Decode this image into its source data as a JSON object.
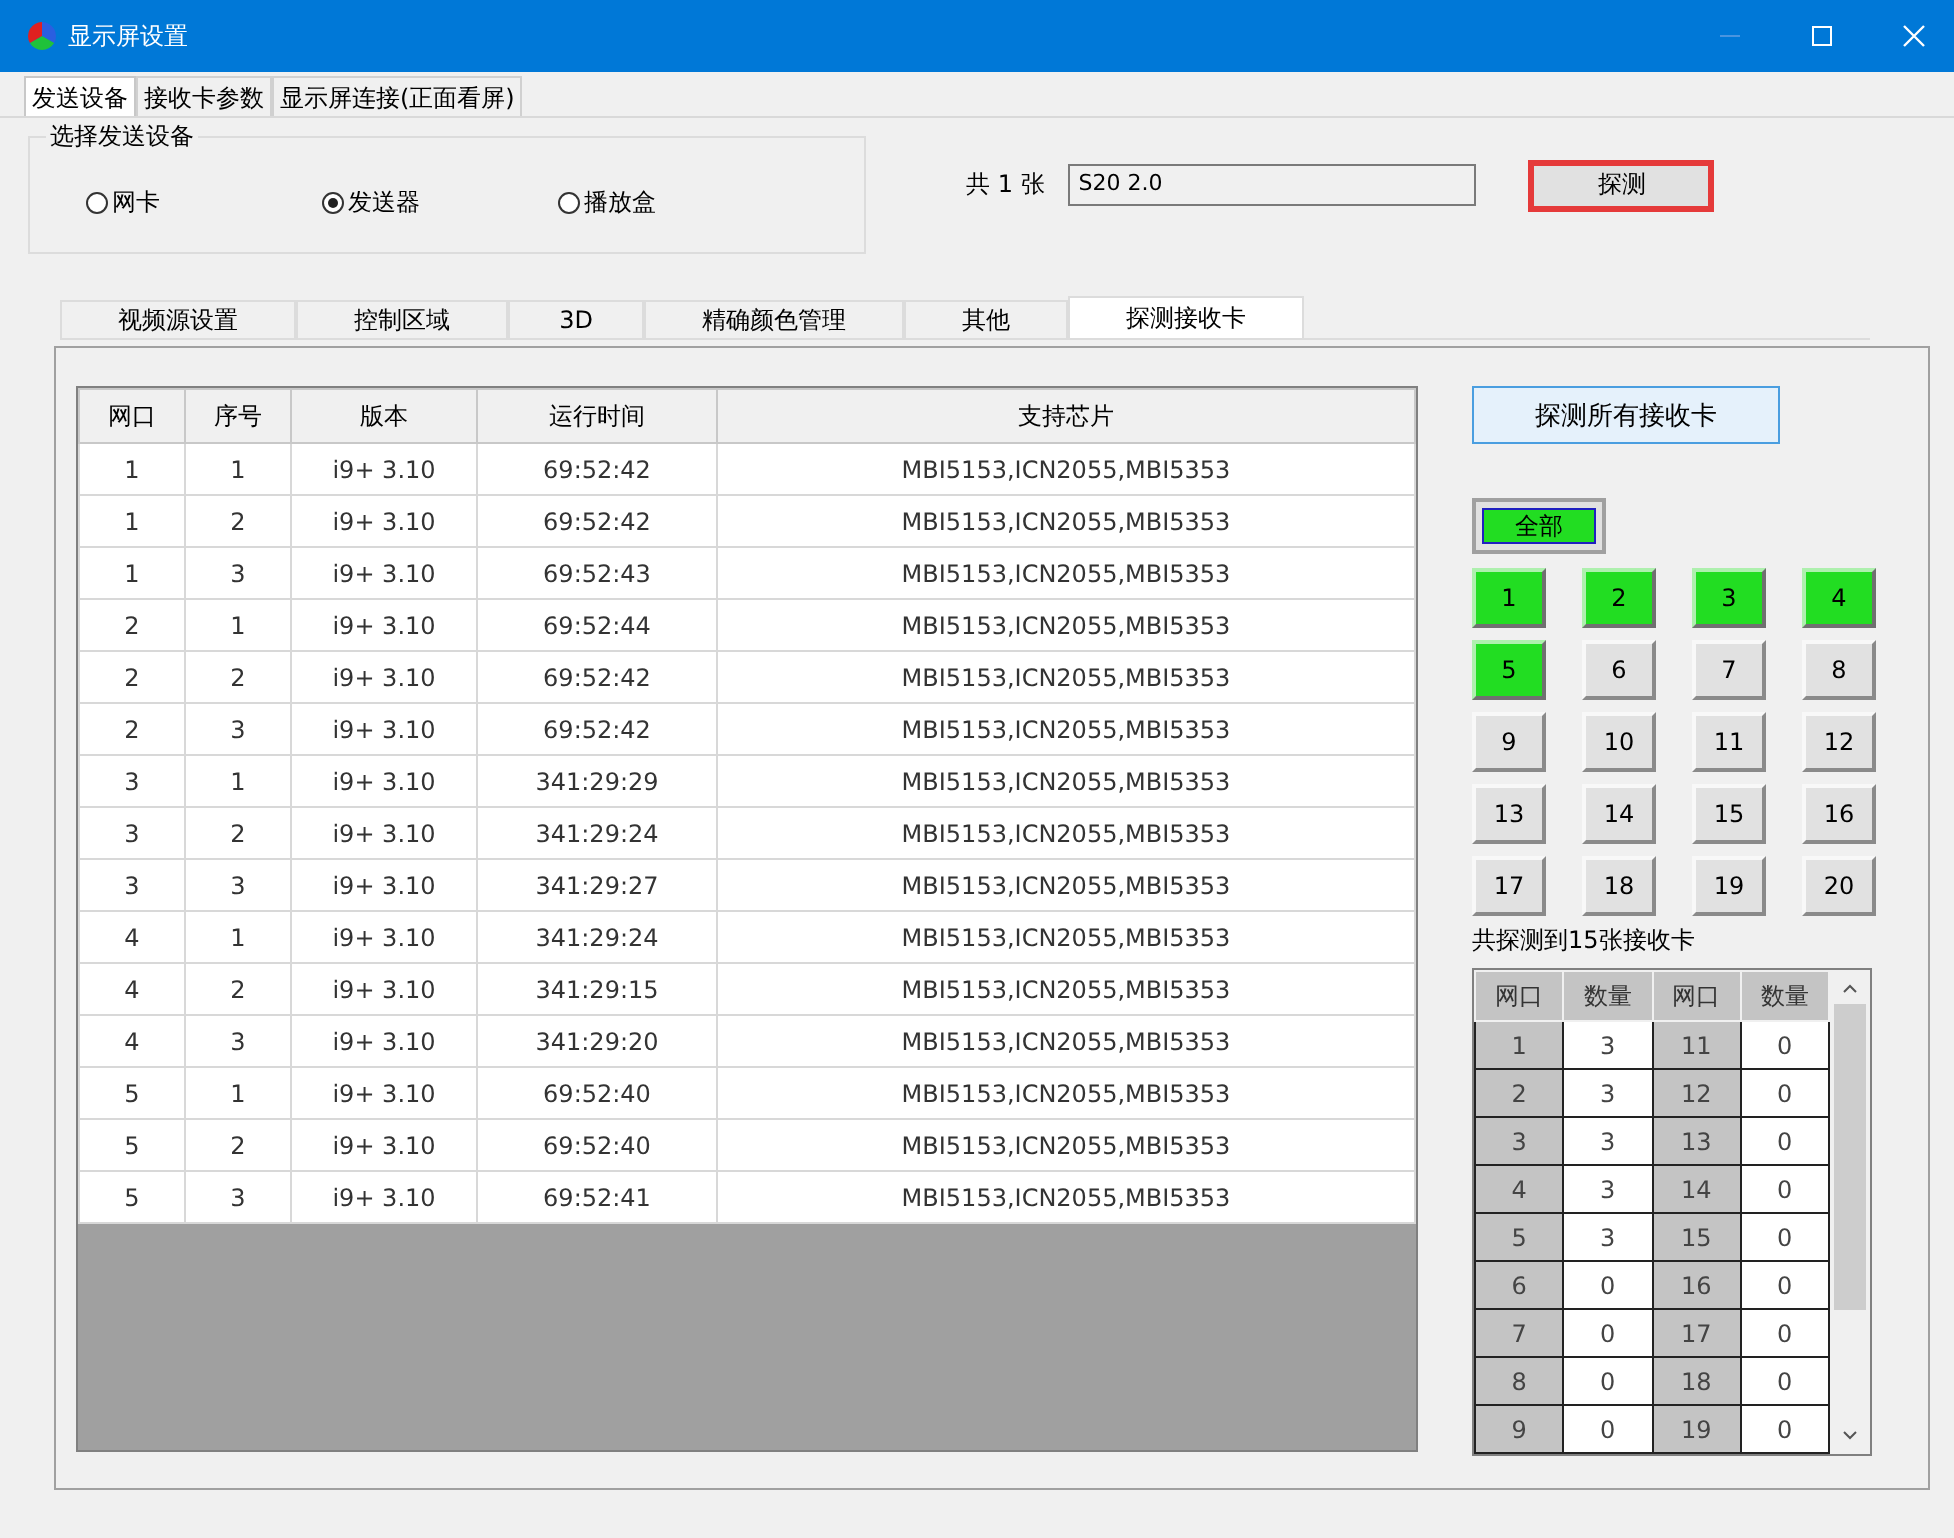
{
  "window": {
    "title": "显示屏设置"
  },
  "top_tabs": [
    {
      "label": "发送设备",
      "selected": true
    },
    {
      "label": "接收卡参数",
      "selected": false
    },
    {
      "label": "显示屏连接(正面看屏)",
      "selected": false
    }
  ],
  "device_group": {
    "title": "选择发送设备",
    "options": [
      {
        "label": "网卡",
        "selected": false
      },
      {
        "label": "发送器",
        "selected": true
      },
      {
        "label": "播放盒",
        "selected": false
      }
    ]
  },
  "count_label": "共 1 张",
  "device_field": {
    "value": "S20 2.0"
  },
  "detect_button": "探测",
  "inner_tabs": [
    {
      "label": "视频源设置",
      "selected": false
    },
    {
      "label": "控制区域",
      "selected": false
    },
    {
      "label": "3D",
      "selected": false
    },
    {
      "label": "精确颜色管理",
      "selected": false
    },
    {
      "label": "其他",
      "selected": false
    },
    {
      "label": "探测接收卡",
      "selected": true
    }
  ],
  "table": {
    "columns": [
      "网口",
      "序号",
      "版本",
      "运行时间",
      "支持芯片"
    ],
    "rows": [
      [
        "1",
        "1",
        "i9+ 3.10",
        "69:52:42",
        "MBI5153,ICN2055,MBI5353"
      ],
      [
        "1",
        "2",
        "i9+ 3.10",
        "69:52:42",
        "MBI5153,ICN2055,MBI5353"
      ],
      [
        "1",
        "3",
        "i9+ 3.10",
        "69:52:43",
        "MBI5153,ICN2055,MBI5353"
      ],
      [
        "2",
        "1",
        "i9+ 3.10",
        "69:52:44",
        "MBI5153,ICN2055,MBI5353"
      ],
      [
        "2",
        "2",
        "i9+ 3.10",
        "69:52:42",
        "MBI5153,ICN2055,MBI5353"
      ],
      [
        "2",
        "3",
        "i9+ 3.10",
        "69:52:42",
        "MBI5153,ICN2055,MBI5353"
      ],
      [
        "3",
        "1",
        "i9+ 3.10",
        "341:29:29",
        "MBI5153,ICN2055,MBI5353"
      ],
      [
        "3",
        "2",
        "i9+ 3.10",
        "341:29:24",
        "MBI5153,ICN2055,MBI5353"
      ],
      [
        "3",
        "3",
        "i9+ 3.10",
        "341:29:27",
        "MBI5153,ICN2055,MBI5353"
      ],
      [
        "4",
        "1",
        "i9+ 3.10",
        "341:29:24",
        "MBI5153,ICN2055,MBI5353"
      ],
      [
        "4",
        "2",
        "i9+ 3.10",
        "341:29:15",
        "MBI5153,ICN2055,MBI5353"
      ],
      [
        "4",
        "3",
        "i9+ 3.10",
        "341:29:20",
        "MBI5153,ICN2055,MBI5353"
      ],
      [
        "5",
        "1",
        "i9+ 3.10",
        "69:52:40",
        "MBI5153,ICN2055,MBI5353"
      ],
      [
        "5",
        "2",
        "i9+ 3.10",
        "69:52:40",
        "MBI5153,ICN2055,MBI5353"
      ],
      [
        "5",
        "3",
        "i9+ 3.10",
        "69:52:41",
        "MBI5153,ICN2055,MBI5353"
      ]
    ]
  },
  "detect_all_button": "探测所有接收卡",
  "all_button": {
    "label": "全部",
    "selected": true
  },
  "port_buttons": [
    {
      "label": "1",
      "selected": true
    },
    {
      "label": "2",
      "selected": true
    },
    {
      "label": "3",
      "selected": true
    },
    {
      "label": "4",
      "selected": true
    },
    {
      "label": "5",
      "selected": true
    },
    {
      "label": "6",
      "selected": false
    },
    {
      "label": "7",
      "selected": false
    },
    {
      "label": "8",
      "selected": false
    },
    {
      "label": "9",
      "selected": false
    },
    {
      "label": "10",
      "selected": false
    },
    {
      "label": "11",
      "selected": false
    },
    {
      "label": "12",
      "selected": false
    },
    {
      "label": "13",
      "selected": false
    },
    {
      "label": "14",
      "selected": false
    },
    {
      "label": "15",
      "selected": false
    },
    {
      "label": "16",
      "selected": false
    },
    {
      "label": "17",
      "selected": false
    },
    {
      "label": "18",
      "selected": false
    },
    {
      "label": "19",
      "selected": false
    },
    {
      "label": "20",
      "selected": false
    }
  ],
  "summary": "共探测到15张接收卡",
  "port_table": {
    "columns": [
      "网口",
      "数量",
      "网口",
      "数量"
    ],
    "rows": [
      [
        "1",
        "3",
        "11",
        "0"
      ],
      [
        "2",
        "3",
        "12",
        "0"
      ],
      [
        "3",
        "3",
        "13",
        "0"
      ],
      [
        "4",
        "3",
        "14",
        "0"
      ],
      [
        "5",
        "3",
        "15",
        "0"
      ],
      [
        "6",
        "0",
        "16",
        "0"
      ],
      [
        "7",
        "0",
        "17",
        "0"
      ],
      [
        "8",
        "0",
        "18",
        "0"
      ],
      [
        "9",
        "0",
        "19",
        "0"
      ]
    ]
  }
}
